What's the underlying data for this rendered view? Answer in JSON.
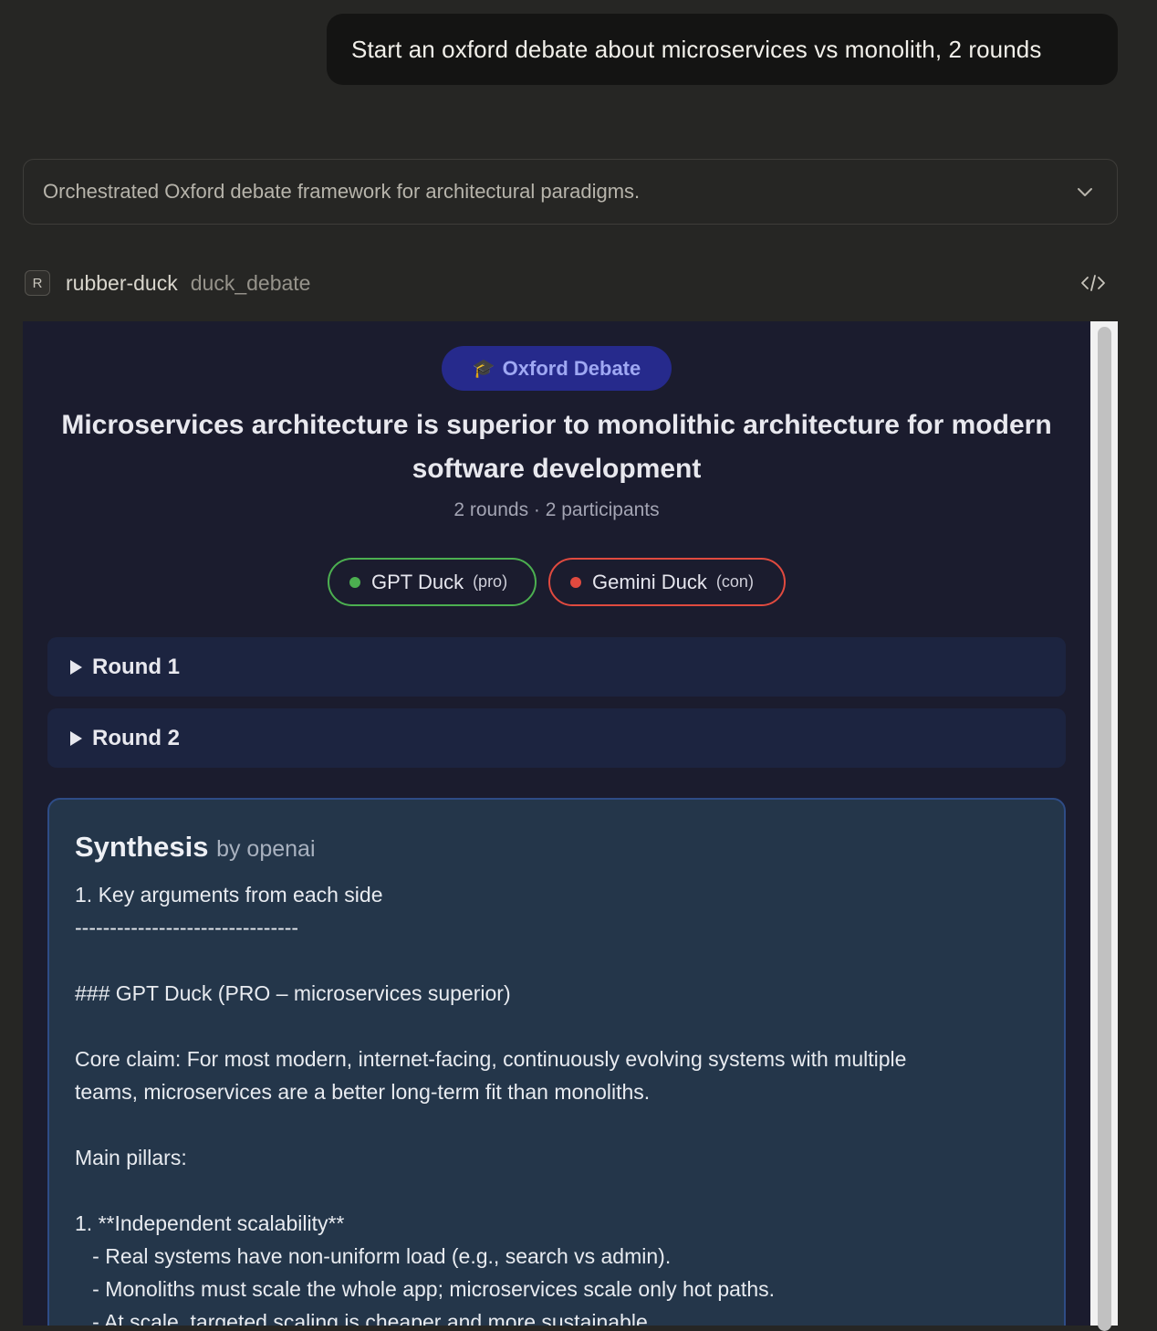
{
  "user_message": "Start an oxford debate about microservices vs monolith, 2 rounds",
  "thinking_summary": "Orchestrated Oxford debate framework for architectural paradigms.",
  "tool": {
    "badge": "R",
    "name": "rubber-duck",
    "function": "duck_debate",
    "code_icon": "code-icon"
  },
  "debate": {
    "format_label": "Oxford Debate",
    "format_icon": "🎓",
    "motion": "Microservices architecture is superior to monolithic architecture for modern software development",
    "meta": "2 rounds · 2 participants",
    "participants": [
      {
        "name": "GPT Duck",
        "role": "(pro)",
        "color": "#4caf50"
      },
      {
        "name": "Gemini Duck",
        "role": "(con)",
        "color": "#e04a3f"
      }
    ],
    "rounds": [
      {
        "label": "Round 1"
      },
      {
        "label": "Round 2"
      }
    ],
    "synthesis": {
      "title": "Synthesis",
      "by": "by openai",
      "body": "1. Key arguments from each side\n--------------------------------\n\n### GPT Duck (PRO – microservices superior)\n\nCore claim: For most modern, internet-facing, continuously evolving systems with multiple\nteams, microservices are a better long-term fit than monoliths.\n\nMain pillars:\n\n1. **Independent scalability**\n   - Real systems have non-uniform load (e.g., search vs admin).\n   - Monoliths must scale the whole app; microservices scale only hot paths.\n   - At scale, targeted scaling is cheaper and more sustainable."
    }
  }
}
